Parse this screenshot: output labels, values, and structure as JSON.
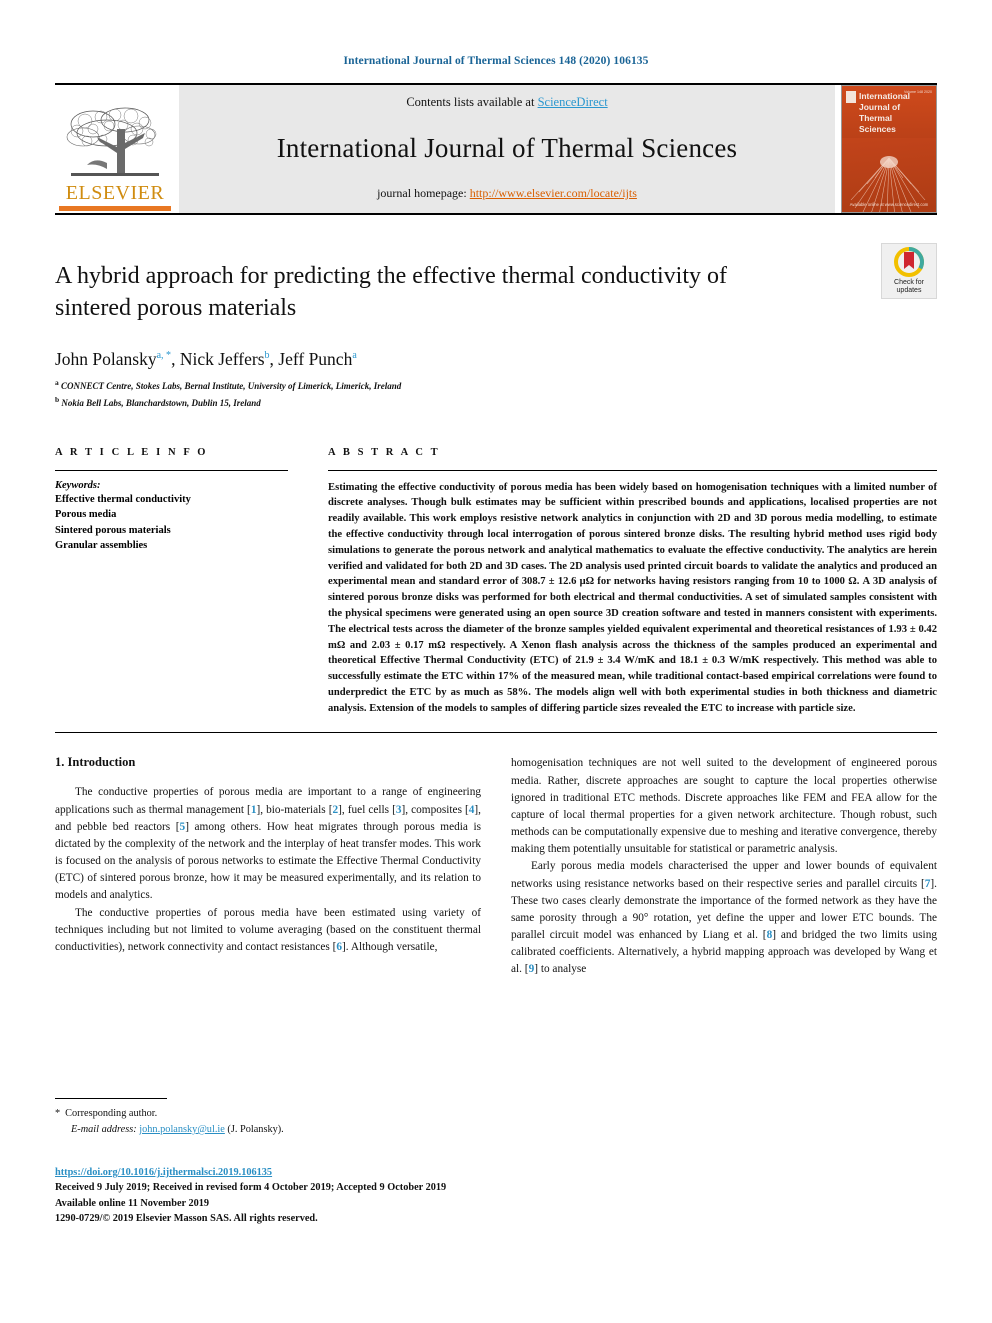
{
  "running_head": "International Journal of Thermal Sciences 148 (2020) 106135",
  "masthead": {
    "contents_prefix": "Contents lists available at ",
    "sciencedirect": "ScienceDirect",
    "journal_title": "International Journal of Thermal Sciences",
    "homepage_prefix": "journal homepage: ",
    "homepage_url": "http://www.elsevier.com/locate/ijts",
    "publisher_word": "ELSEVIER",
    "cover": {
      "line1": "International",
      "line2": "Journal of",
      "line3": "Thermal",
      "line4": "Sciences",
      "issue": "Volume 148  2020",
      "footer": "Available online at www.sciencedirect.com"
    }
  },
  "crossmark": {
    "line1": "Check for",
    "line2": "updates"
  },
  "title": "A hybrid approach for predicting the effective thermal conductivity of sintered porous materials",
  "authors": [
    {
      "name": "John Polansky",
      "marks": "a, *"
    },
    {
      "name": "Nick Jeffers",
      "marks": "b"
    },
    {
      "name": "Jeff Punch",
      "marks": "a"
    }
  ],
  "affiliations": [
    {
      "mark": "a",
      "text": "CONNECT Centre, Stokes Labs, Bernal Institute, University of Limerick, Limerick, Ireland"
    },
    {
      "mark": "b",
      "text": "Nokia Bell Labs, Blanchardstown, Dublin 15, Ireland"
    }
  ],
  "article_info": {
    "heading": "A R T I C L E   I N F O",
    "keywords_label": "Keywords:",
    "keywords": [
      "Effective thermal conductivity",
      "Porous media",
      "Sintered porous materials",
      "Granular assemblies"
    ]
  },
  "abstract": {
    "heading": "A B S T R A C T",
    "text": "Estimating the effective conductivity of porous media has been widely based on homogenisation techniques with a limited number of discrete analyses. Though bulk estimates may be sufficient within prescribed bounds and applications, localised properties are not readily available. This work employs resistive network analytics in conjunction with 2D and 3D porous media modelling, to estimate the effective conductivity through local interrogation of porous sintered bronze disks. The resulting hybrid method uses rigid body simulations to generate the porous network and analytical mathematics to evaluate the effective conductivity. The analytics are herein verified and validated for both 2D and 3D cases. The 2D analysis used printed circuit boards to validate the analytics and produced an experimental mean and standard error of 308.7 ± 12.6 μΩ for networks having resistors ranging from 10 to 1000 Ω. A 3D analysis of sintered porous bronze disks was performed for both electrical and thermal conductivities. A set of simulated samples consistent with the physical specimens were generated using an open source 3D creation software and tested in manners consistent with experiments. The electrical tests across the diameter of the bronze samples yielded equivalent experimental and theoretical resistances of 1.93 ± 0.42 mΩ and 2.03 ± 0.17 mΩ respectively. A Xenon flash analysis across the thickness of the samples produced an experimental and theoretical Effective Thermal Conductivity (ETC) of 21.9 ± 3.4 W/mK and 18.1 ± 0.3 W/mK respectively. This method was able to successfully estimate the ETC within 17% of the measured mean, while traditional contact-based empirical correlations were found to underpredict the ETC by as much as 58%. The models align well with both experimental studies in both thickness and diametric analysis. Extension of the models to samples of differing particle sizes revealed the ETC to increase with particle size."
  },
  "introduction": {
    "heading": "1.  Introduction",
    "left_paragraphs": [
      "The conductive properties of porous media are important to a range of engineering applications such as thermal management [1], biomaterials [2], fuel cells [3], composites [4], and pebble bed reactors [5] among others. How heat migrates through porous media is dictated by the complexity of the network and the interplay of heat transfer modes. This work is focused on the analysis of porous networks to estimate the Effective Thermal Conductivity (ETC) of sintered porous bronze, how it may be measured experimentally, and its relation to models and analytics.",
      "The conductive properties of porous media have been estimated using variety of techniques including but not limited to volume averaging (based on the constituent thermal conductivities), network connectivity and contact resistances [6]. Although versatile,"
    ],
    "right_paragraphs": [
      "homogenisation techniques are not well suited to the development of engineered porous media. Rather, discrete approaches are sought to capture the local properties otherwise ignored in traditional ETC methods. Discrete approaches like FEM and FEA allow for the capture of local thermal properties for a given network architecture. Though robust, such methods can be computationally expensive due to meshing and iterative convergence, thereby making them potentially unsuitable for statistical or parametric analysis.",
      "Early porous media models characterised the upper and lower bounds of equivalent networks using resistance networks based on their respective series and parallel circuits [7]. These two cases clearly demonstrate the importance of the formed network as they have the same porosity through a 90° rotation, yet define the upper and lower ETC bounds. The parallel circuit model was enhanced by Liang et al. [8] and bridged the two limits using calibrated coefficients. Alternatively, a hybrid mapping approach was developed by Wang et al. [9] to analyse"
    ]
  },
  "footnote": {
    "star": "*",
    "corresponding": "Corresponding author.",
    "email_label": "E-mail address:",
    "email": "john.polansky@ul.ie",
    "email_owner": "(J. Polansky)."
  },
  "footer": {
    "doi": "https://doi.org/10.1016/j.ijthermalsci.2019.106135",
    "dates": "Received 9 July 2019; Received in revised form 4 October 2019; Accepted 9 October 2019",
    "available": "Available online 11 November 2019",
    "copyright": "1290-0729/© 2019 Elsevier Masson SAS. All rights reserved."
  },
  "colors": {
    "link_blue": "#2a8fc4",
    "running_head_blue": "#1a6496",
    "elsevier_orange": "#e87722",
    "homepage_orange": "#d95f02",
    "cover_rust": "#c0431a"
  }
}
